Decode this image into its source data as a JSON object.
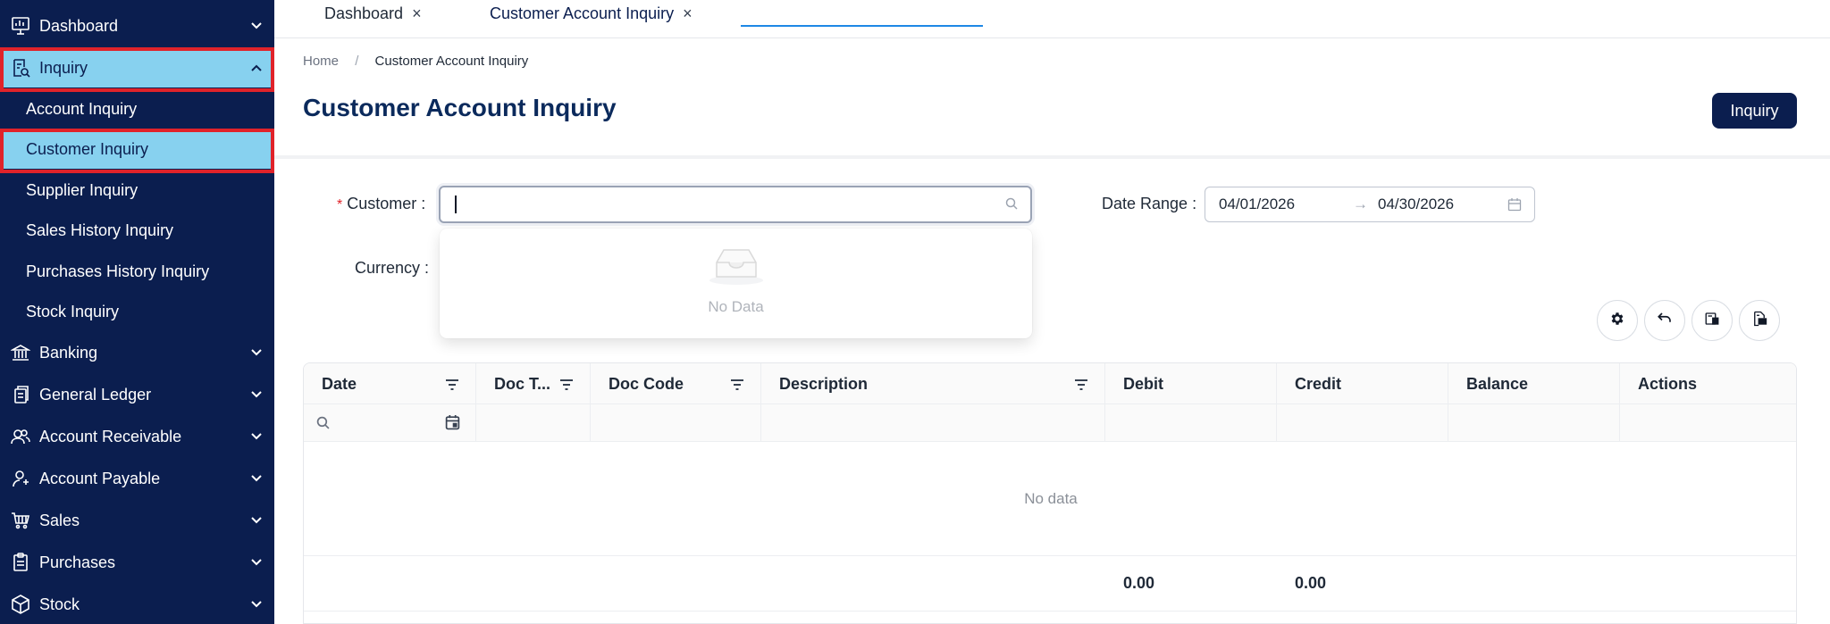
{
  "sidebar": {
    "items": [
      {
        "label": "Dashboard",
        "icon": "dashboard-chart-icon"
      },
      {
        "label": "Inquiry",
        "icon": "inquiry-search-doc-icon"
      },
      {
        "label": "Banking",
        "icon": "bank-icon"
      },
      {
        "label": "General Ledger",
        "icon": "ledger-icon"
      },
      {
        "label": "Account Receivable",
        "icon": "users-icon"
      },
      {
        "label": "Account Payable",
        "icon": "user-pay-icon"
      },
      {
        "label": "Sales",
        "icon": "cart-icon"
      },
      {
        "label": "Purchases",
        "icon": "clipboard-icon"
      },
      {
        "label": "Stock",
        "icon": "box-icon"
      }
    ],
    "inquiry_subitems": [
      {
        "label": "Account Inquiry"
      },
      {
        "label": "Customer Inquiry"
      },
      {
        "label": "Supplier Inquiry"
      },
      {
        "label": "Sales History Inquiry"
      },
      {
        "label": "Purchases History Inquiry"
      },
      {
        "label": "Stock Inquiry"
      }
    ],
    "active_item": "Inquiry",
    "active_subitem": "Customer Inquiry"
  },
  "tabs": [
    {
      "label": "Dashboard",
      "close": "×"
    },
    {
      "label": "Customer Account Inquiry",
      "close": "×"
    }
  ],
  "breadcrumb": {
    "home": "Home",
    "sep": "/",
    "current": "Customer Account Inquiry"
  },
  "page": {
    "title": "Customer Account Inquiry",
    "inquiry_button": "Inquiry"
  },
  "form": {
    "customer_label": "Customer :",
    "required_mark": "*",
    "customer_value": "",
    "date_range_label": "Date Range :",
    "date_from": "04/01/2026",
    "date_arrow": "→",
    "date_to": "04/30/2026",
    "currency_label": "Currency :"
  },
  "dropdown": {
    "empty_text": "No Data"
  },
  "toolbar": {
    "icons": [
      "gear-icon",
      "undo-icon",
      "export-sheet-icon",
      "export-csv-icon"
    ]
  },
  "table": {
    "columns": [
      "Date",
      "Doc T...",
      "Doc Code",
      "Description",
      "Debit",
      "Credit",
      "Balance",
      "Actions"
    ],
    "empty_text": "No data",
    "totals": {
      "debit": "0.00",
      "credit": "0.00"
    }
  },
  "colors": {
    "sidebar_bg": "#0b1e4f",
    "active_bg": "#87d1ef",
    "highlight": "#e0232a",
    "primary": "#0b1e4f"
  }
}
